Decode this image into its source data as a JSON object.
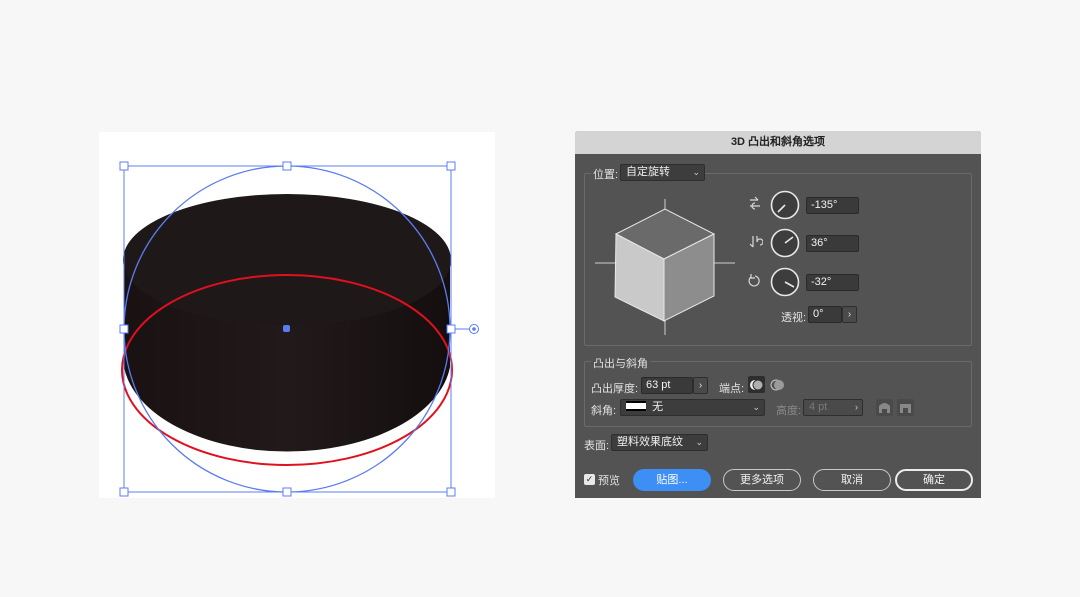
{
  "dialog": {
    "title": "3D 凸出和斜角选项",
    "position": {
      "label": "位置:",
      "preset": "自定旋转",
      "x_angle": "-135°",
      "y_angle": "36°",
      "z_angle": "-32°",
      "perspective_label": "透视:",
      "perspective": "0°"
    },
    "extrude": {
      "section_title": "凸出与斜角",
      "depth_label": "凸出厚度:",
      "depth": "63 pt",
      "cap_label": "端点:",
      "bevel_label": "斜角:",
      "bevel": "无",
      "height_label": "高度:",
      "height": "4 pt"
    },
    "surface": {
      "label": "表面:",
      "value": "塑料效果底纹"
    },
    "preview_label": "预览",
    "preview_checked": true,
    "buttons": {
      "map": "贴图...",
      "more": "更多选项",
      "cancel": "取消",
      "ok": "确定"
    }
  },
  "colors": {
    "selection": "#5b7cf0",
    "path_red": "#e0101e",
    "object_fill": "#1c1414",
    "dialog_bg": "#535353",
    "accent": "#3d8ef5"
  }
}
